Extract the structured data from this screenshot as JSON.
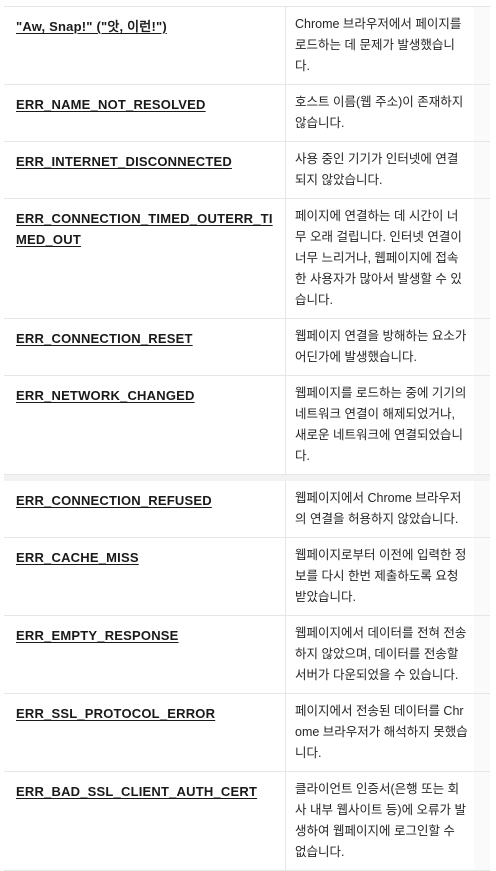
{
  "rows": [
    {
      "code": "\"Aw, Snap!\" (\"앗, 이런!\")",
      "desc": "Chrome 브라우저에서 페이지를 로드하는 데 문제가 발생했습니다."
    },
    {
      "code": "ERR_NAME_NOT_RESOLVED",
      "desc": "호스트 이름(웹 주소)이 존재하지 않습니다."
    },
    {
      "code": "ERR_INTERNET_DISCONNECTED",
      "desc": "사용 중인 기기가 인터넷에 연결되지 않았습니다."
    },
    {
      "code": "ERR_CONNECTION_TIMED_OUTERR_TIMED_OUT",
      "desc": "페이지에 연결하는 데 시간이 너무 오래 걸립니다. 인터넷 연결이 너무 느리거나, 웹페이지에 접속한 사용자가 많아서 발생할 수 있습니다."
    },
    {
      "code": "ERR_CONNECTION_RESET",
      "desc": "웹페이지 연결을 방해하는 요소가 어딘가에 발생했습니다."
    },
    {
      "code": "ERR_NETWORK_CHANGED",
      "desc": "웹페이지를 로드하는 중에 기기의 네트워크 연결이 해제되었거나, 새로운 네트워크에 연결되었습니다."
    },
    {
      "code": "ERR_CONNECTION_REFUSED",
      "desc": "웹페이지에서 Chrome 브라우저의 연결을 허용하지 않았습니다."
    },
    {
      "code": "ERR_CACHE_MISS",
      "desc": "웹페이지로부터 이전에 입력한 정보를 다시 한번 제출하도록 요청받았습니다."
    },
    {
      "code": "ERR_EMPTY_RESPONSE",
      "desc": "웹페이지에서 데이터를 전혀 전송하지 않았으며, 데이터를 전송할 서버가 다운되었을 수 있습니다."
    },
    {
      "code": "ERR_SSL_PROTOCOL_ERROR",
      "desc": "페이지에서 전송된 데이터를 Chrome 브라우저가 해석하지 못했습니다."
    },
    {
      "code": "ERR_BAD_SSL_CLIENT_AUTH_CERT",
      "desc": "클라이언트 인증서(은행 또는 회사 내부 웹사이트 등)에 오류가 발생하여 웹페이지에 로그인할 수 없습니다."
    }
  ]
}
